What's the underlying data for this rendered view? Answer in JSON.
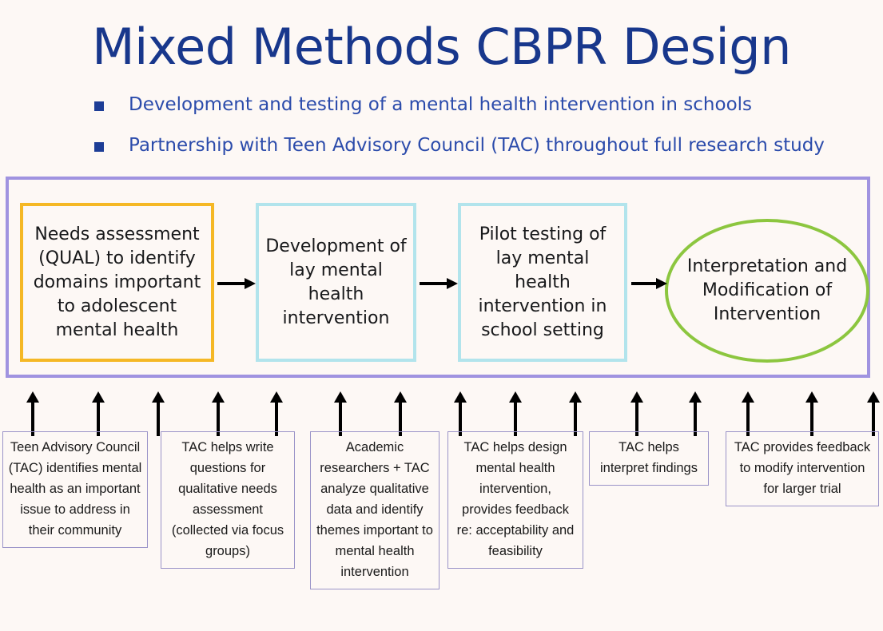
{
  "slide": {
    "title": "Mixed Methods CBPR Design",
    "background_color": "#fdf8f5",
    "title_color": "#18378c"
  },
  "bullets": [
    {
      "marker": "square-bullet",
      "text": "Development and testing of a mental health intervention in schools"
    },
    {
      "marker": "square-bullet",
      "text": "Partnership with Teen Advisory Council (TAC) throughout full research study"
    }
  ],
  "flow": {
    "container_border_color": "#a093e0",
    "steps": [
      {
        "id": "needs-assessment",
        "shape": "rectangle",
        "border_color": "#f5b825",
        "text": "Needs assessment (QUAL) to identify domains important to adolescent mental health"
      },
      {
        "id": "development",
        "shape": "rectangle",
        "border_color": "#b2e4ec",
        "text": "Development of lay mental health intervention"
      },
      {
        "id": "pilot-testing",
        "shape": "rectangle",
        "border_color": "#b2e4ec",
        "text": "Pilot testing of lay mental health intervention in school setting"
      },
      {
        "id": "interpretation",
        "shape": "ellipse",
        "border_color": "#8cc63f",
        "text": "Interpretation and Modification of Intervention"
      }
    ]
  },
  "notes": {
    "border_color": "#9a93c8",
    "items": [
      {
        "id": "teen-advisory-council",
        "text": "Teen Advisory Council (TAC) identifies mental health as an important issue to address in their community"
      },
      {
        "id": "tac-write-questions",
        "text": "TAC helps write questions for qualitative needs assessment (collected via focus groups)"
      },
      {
        "id": "analyze-qualitative-data",
        "text": "Academic researchers + TAC analyze qualitative data and identify themes important to mental health intervention"
      },
      {
        "id": "design-intervention",
        "text": "TAC helps design mental health intervention, provides feedback re: acceptability and feasibility"
      },
      {
        "id": "interpret-findings",
        "text": "TAC helps interpret findings"
      },
      {
        "id": "modify-intervention",
        "text": "TAC provides feedback to modify intervention for larger trial"
      }
    ]
  },
  "arrows": {
    "horizontal_count": 3,
    "vertical_count": 15
  }
}
